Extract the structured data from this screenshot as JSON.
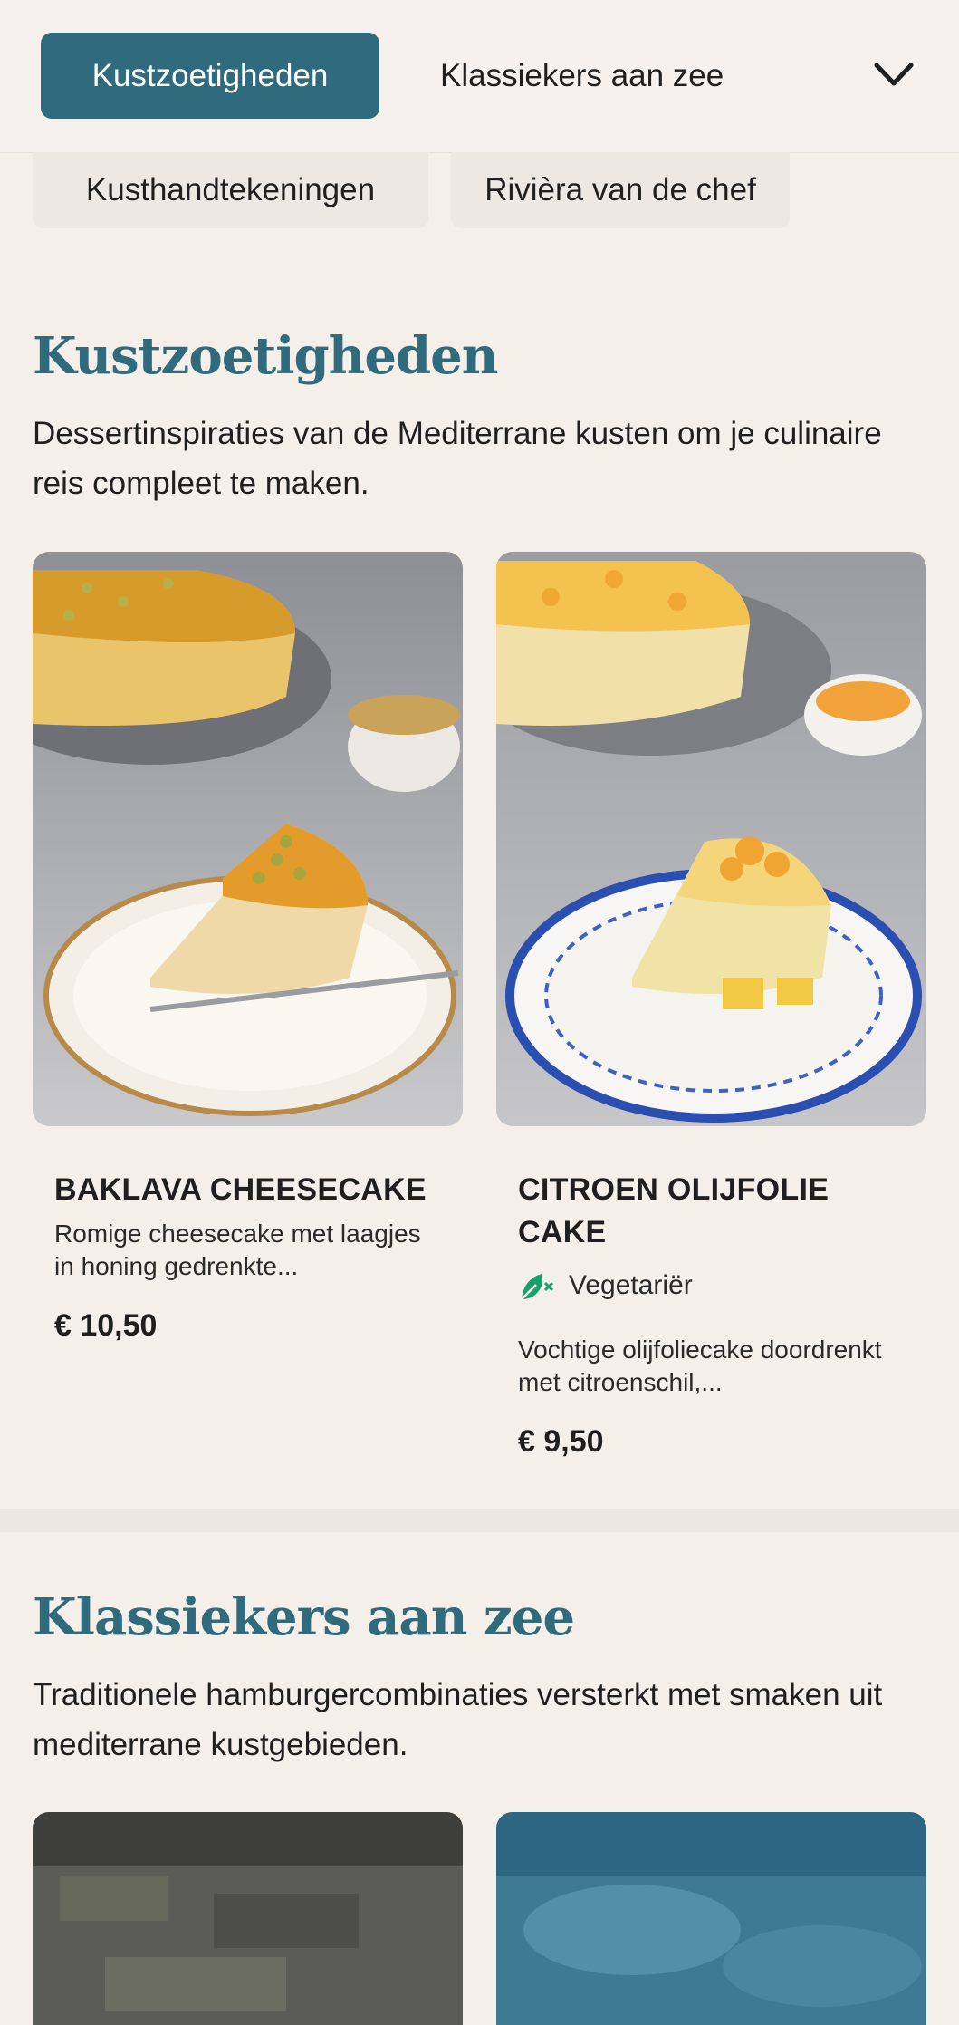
{
  "nav": {
    "active_tab": "Kustzoetigheden",
    "second_tab": "Klassiekers aan zee",
    "chips": [
      "Kusthandtekeningen",
      "Rivièra van de chef"
    ]
  },
  "sections": [
    {
      "title": "Kustzoetigheden",
      "description": "Dessertinspiraties van de Mediterrane kusten om je culinaire reis compleet te maken.",
      "items": [
        {
          "name": "BAKLAVA CHEESECAKE",
          "description": "Romige cheesecake met laagjes in honing gedrenkte...",
          "price": "€ 10,50"
        },
        {
          "name": "CITROEN OLIJFOLIE CAKE",
          "badge": "Vegetariër",
          "description": "Vochtige olijfoliecake doordrenkt met citroenschil,...",
          "price": "€ 9,50"
        }
      ]
    },
    {
      "title": "Klassiekers aan zee",
      "description": "Traditionele hamburgercombinaties versterkt met smaken uit mediterrane kustgebieden."
    }
  ],
  "colors": {
    "accent": "#2f6b7c",
    "background": "#f5efea",
    "vegetarian": "#1aa06a"
  },
  "icons": {
    "dropdown": "chevron-down-icon",
    "vegetarian": "leaf-icon"
  }
}
